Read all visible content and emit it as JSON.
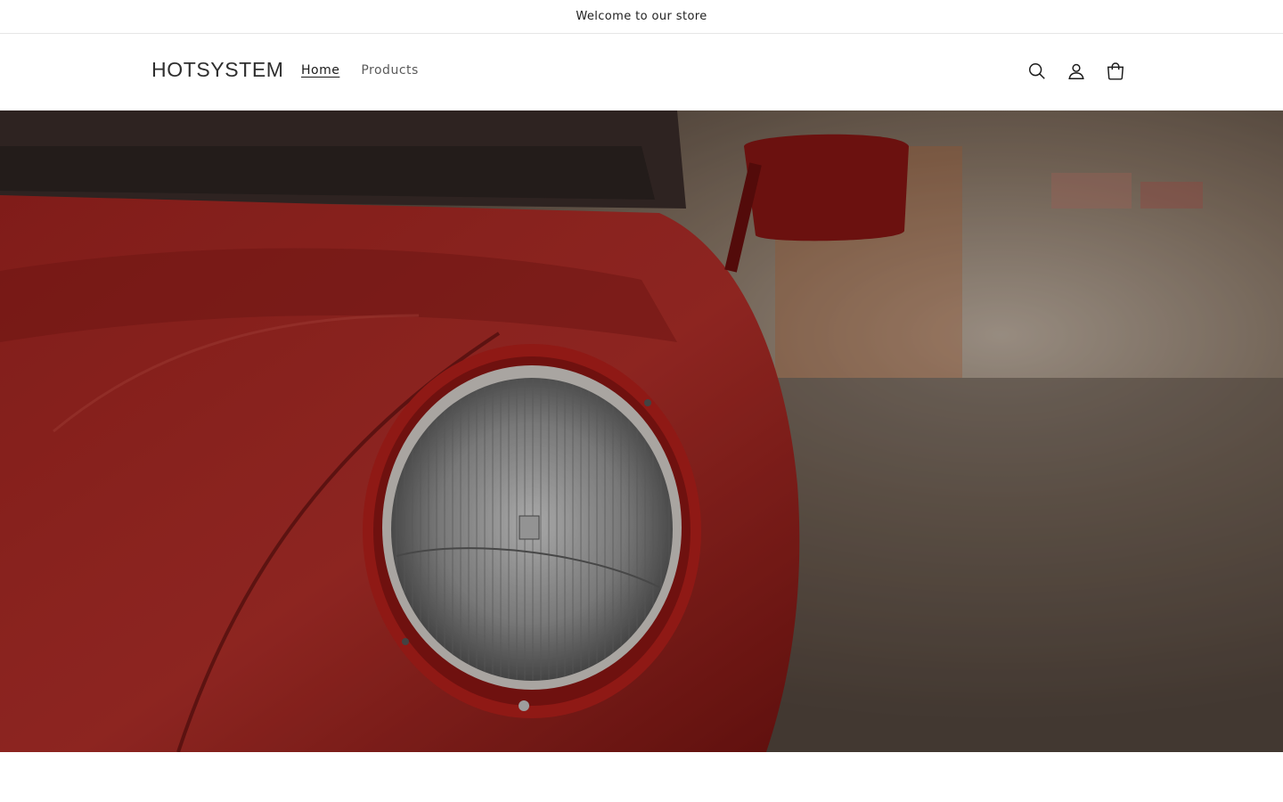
{
  "announcement": {
    "text": "Welcome to our store"
  },
  "header": {
    "logo": "HOTSYSTEM",
    "nav": [
      {
        "label": "Home",
        "active": true
      },
      {
        "label": "Products",
        "active": false
      }
    ],
    "icons": [
      "search-icon",
      "account-icon",
      "cart-icon"
    ]
  },
  "hero": {
    "image": "red classic car headlight",
    "accent_color": "#8c1a18"
  }
}
